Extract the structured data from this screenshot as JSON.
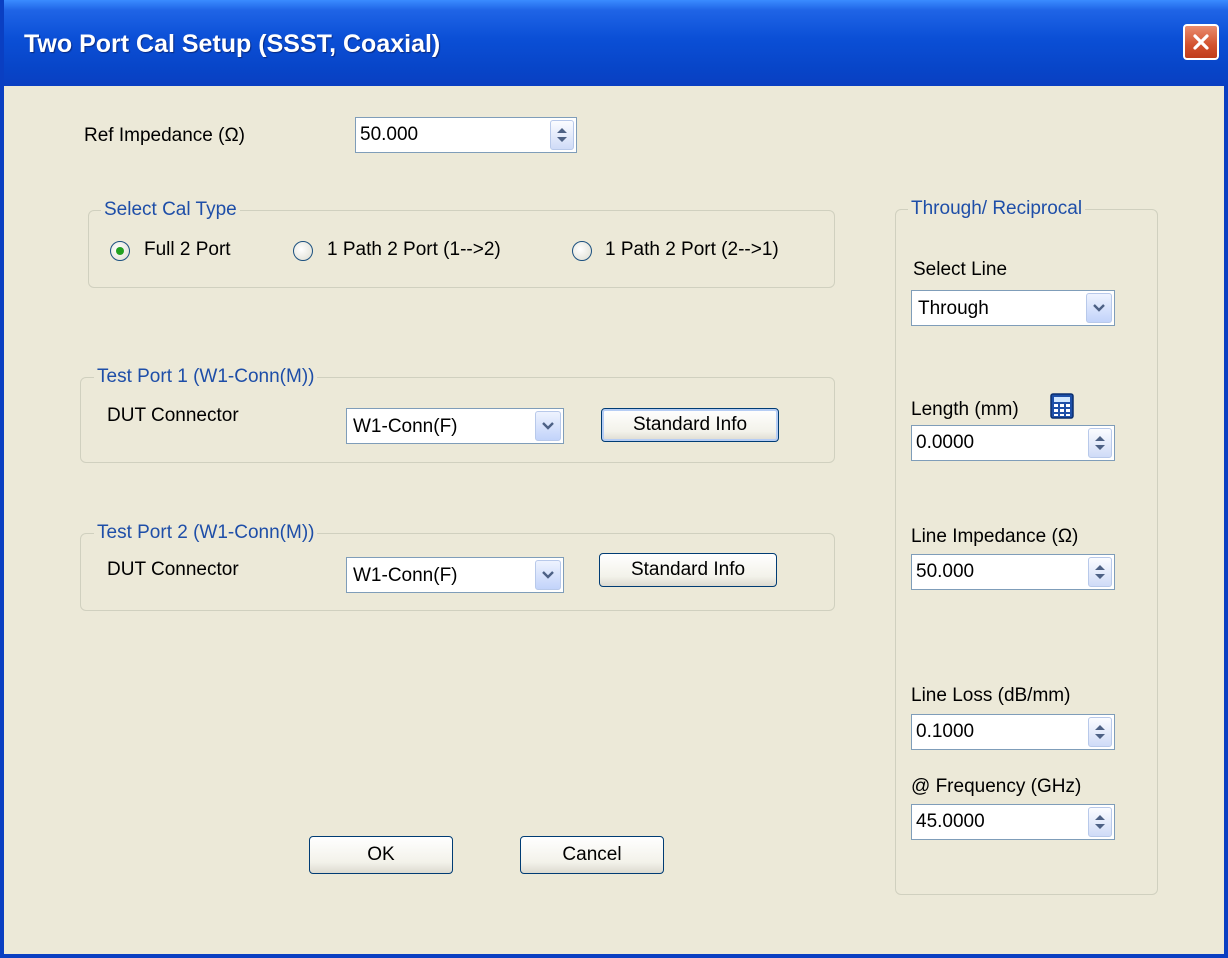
{
  "window": {
    "title": "Two Port Cal Setup (SSST, Coaxial)"
  },
  "ref_impedance": {
    "label": "Ref Impedance (Ω)",
    "value": "50.000"
  },
  "cal_type": {
    "legend": "Select Cal Type",
    "options": [
      "Full 2 Port",
      "1 Path 2 Port (1-->2)",
      "1 Path 2 Port (2-->1)"
    ],
    "selected": "Full 2 Port"
  },
  "test_port_1": {
    "legend": "Test Port 1 (W1-Conn(M))",
    "dut_label": "DUT Connector",
    "connector": "W1-Conn(F)",
    "std_info_label": "Standard Info"
  },
  "test_port_2": {
    "legend": "Test Port 2 (W1-Conn(M))",
    "dut_label": "DUT Connector",
    "connector": "W1-Conn(F)",
    "std_info_label": "Standard Info"
  },
  "through": {
    "legend": "Through/ Reciprocal",
    "select_line_label": "Select Line",
    "select_line_value": "Through",
    "length_label": "Length (mm)",
    "length_value": "0.0000",
    "line_impedance_label": "Line Impedance (Ω)",
    "line_impedance_value": "50.000",
    "line_loss_label": "Line Loss (dB/mm)",
    "line_loss_value": "0.1000",
    "frequency_label": "@ Frequency (GHz)",
    "frequency_value": "45.0000"
  },
  "buttons": {
    "ok": "OK",
    "cancel": "Cancel"
  },
  "colors": {
    "title_bar": "#0a3fc2",
    "dialog_bg": "#ece9d8",
    "legend_text": "#1e4ea8",
    "radio_dot": "#21a121",
    "close_button": "#d2512e"
  },
  "icons": [
    "close-icon",
    "spin-arrows-icon",
    "dropdown-arrow-icon",
    "calculator-icon"
  ]
}
